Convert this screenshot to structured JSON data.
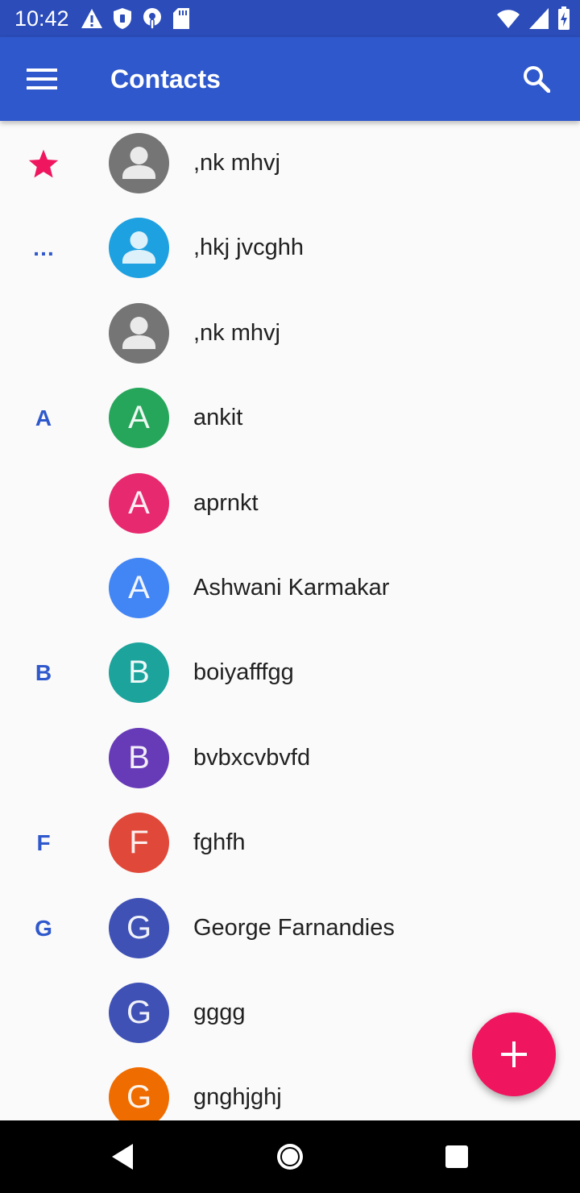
{
  "status_bar": {
    "time": "10:42",
    "icons_left": [
      "warning-icon",
      "shield-icon",
      "podcast-icon",
      "sd-card-icon"
    ],
    "icons_right": [
      "wifi-icon",
      "cell-signal-icon",
      "battery-icon"
    ]
  },
  "app_bar": {
    "title": "Contacts",
    "menu_icon": "hamburger-menu-icon",
    "search_icon": "search-icon"
  },
  "contacts": [
    {
      "header": "★",
      "header_type": "star",
      "name": ",nk mhvj",
      "avatar_type": "person",
      "color": "#757575",
      "letter": ""
    },
    {
      "header": "…",
      "header_type": "text",
      "name": ",hkj jvcghh",
      "avatar_type": "person",
      "color": "#1ea1e0",
      "letter": ""
    },
    {
      "header": "",
      "header_type": "text",
      "name": ",nk mhvj",
      "avatar_type": "person",
      "color": "#757575",
      "letter": ""
    },
    {
      "header": "A",
      "header_type": "text",
      "name": "ankit",
      "avatar_type": "letter",
      "color": "#26a65b",
      "letter": "A"
    },
    {
      "header": "",
      "header_type": "text",
      "name": "aprnkt",
      "avatar_type": "letter",
      "color": "#e72a6f",
      "letter": "A"
    },
    {
      "header": "",
      "header_type": "text",
      "name": "Ashwani Karmakar",
      "avatar_type": "letter",
      "color": "#4285f4",
      "letter": "A"
    },
    {
      "header": "B",
      "header_type": "text",
      "name": "boiyafffgg",
      "avatar_type": "letter",
      "color": "#1ba39c",
      "letter": "B"
    },
    {
      "header": "",
      "header_type": "text",
      "name": "bvbxcvbvfd",
      "avatar_type": "letter",
      "color": "#673ab7",
      "letter": "B"
    },
    {
      "header": "F",
      "header_type": "text",
      "name": "fghfh",
      "avatar_type": "letter",
      "color": "#e0493a",
      "letter": "F"
    },
    {
      "header": "G",
      "header_type": "text",
      "name": "George Farnandies",
      "avatar_type": "letter",
      "color": "#3f51b5",
      "letter": "G"
    },
    {
      "header": "",
      "header_type": "text",
      "name": "gggg",
      "avatar_type": "letter",
      "color": "#3f51b5",
      "letter": "G"
    },
    {
      "header": "",
      "header_type": "text",
      "name": "gnghjghj",
      "avatar_type": "letter",
      "color": "#ef6c00",
      "letter": "G"
    }
  ],
  "fab": {
    "icon": "add-icon"
  },
  "nav_bar": {
    "icons": [
      "back-icon",
      "home-icon",
      "recents-icon"
    ]
  },
  "colors": {
    "status_bar": "#2b4cb9",
    "app_bar": "#2f58cc",
    "fab": "#f0155f",
    "star": "#f0155f",
    "header_letter": "#2f58cc"
  }
}
